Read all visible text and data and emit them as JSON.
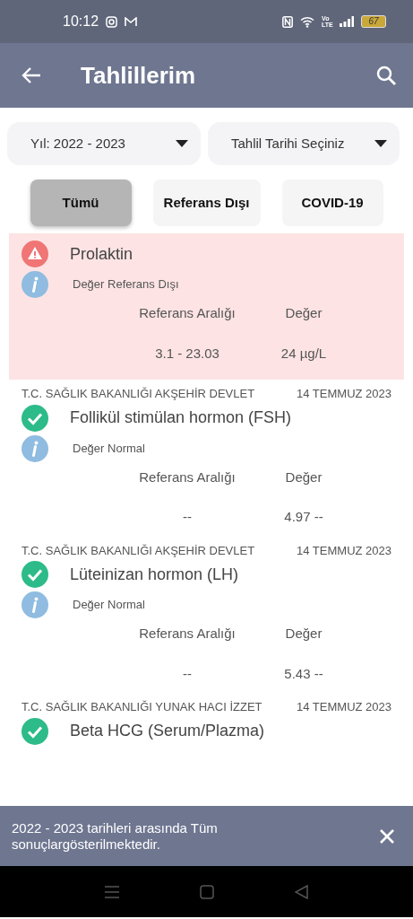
{
  "status_bar": {
    "time": "10:12",
    "volte": "Vo LTE",
    "battery": "67"
  },
  "app_bar": {
    "title": "Tahlillerim"
  },
  "filters": [
    {
      "label": "Yıl: 2022 - 2023"
    },
    {
      "label": "Tahlil Tarihi Seçiniz"
    }
  ],
  "tabs": [
    {
      "label": "Tümü",
      "selected": true
    },
    {
      "label": "Referans Dışı",
      "selected": false
    },
    {
      "label": "COVID-19",
      "selected": false
    }
  ],
  "results": [
    {
      "kind": "abnormal",
      "name": "Prolaktin",
      "note": "Değer Referans Dışı",
      "range_label": "Referans Aralığı",
      "value_label": "Değer",
      "range": "3.1 - 23.03",
      "value": "24 µg/L"
    },
    {
      "kind": "normal",
      "hospital": "T.C. SAĞLIK BAKANLIĞI AKŞEHİR DEVLET",
      "date": "14 TEMMUZ 2023",
      "name": "Follikül stimülan hormon (FSH)",
      "note": "Değer Normal",
      "range_label": "Referans Aralığı",
      "value_label": "Değer",
      "range": "--",
      "value": "4.97 --"
    },
    {
      "kind": "normal",
      "hospital": "T.C. SAĞLIK BAKANLIĞI AKŞEHİR DEVLET",
      "date": "14 TEMMUZ 2023",
      "name": "Lüteinizan hormon (LH)",
      "note": "Değer Normal",
      "range_label": "Referans Aralığı",
      "value_label": "Değer",
      "range": "--",
      "value": "5.43 --"
    },
    {
      "kind": "normal",
      "hospital": "T.C. SAĞLIK BAKANLIĞI YUNAK HACI İZZET",
      "date": "14 TEMMUZ 2023",
      "name": "Beta HCG (Serum/Plazma)"
    }
  ],
  "snackbar": {
    "message": "2022 - 2023 tarihleri arasında Tüm sonuçlargösterilmektedir."
  }
}
